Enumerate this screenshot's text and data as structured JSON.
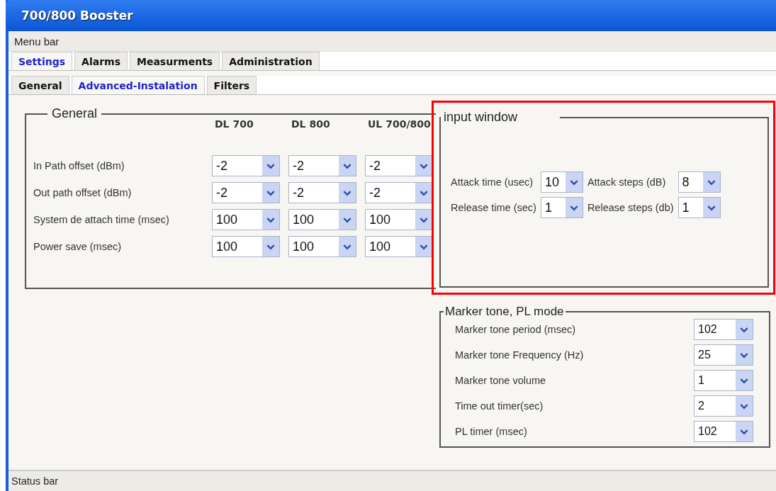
{
  "window": {
    "title": "700/800 Booster"
  },
  "menu_bar": "Menu bar",
  "tabs": [
    {
      "label": "Settings",
      "selected": true
    },
    {
      "label": "Alarms",
      "selected": false
    },
    {
      "label": "Measurments",
      "selected": false
    },
    {
      "label": "Administration",
      "selected": false
    }
  ],
  "subtabs": [
    {
      "label": "General",
      "selected": false
    },
    {
      "label": "Advanced-Instalation",
      "selected": true
    },
    {
      "label": "Filters",
      "selected": false
    }
  ],
  "general": {
    "title": "General",
    "columns": [
      "DL 700",
      "DL 800",
      "UL 700/800"
    ],
    "rows": [
      {
        "label": "In Path offset  (dBm)",
        "values": [
          "-2",
          "-2",
          "-2"
        ]
      },
      {
        "label": "Out path offset (dBm)",
        "values": [
          "-2",
          "-2",
          "-2"
        ]
      },
      {
        "label": "System de attach time (msec)",
        "values": [
          "100",
          "100",
          "100"
        ]
      },
      {
        "label": "Power save (msec)",
        "values": [
          "100",
          "100",
          "100"
        ]
      }
    ]
  },
  "input_window": {
    "title": "input window",
    "highlighted": true,
    "fields": [
      {
        "label": "Attack time (usec)",
        "value": "10"
      },
      {
        "label": "Attack steps (dB)",
        "value": "8"
      },
      {
        "label": "Release time (sec)",
        "value": "1"
      },
      {
        "label": "Release steps (db)",
        "value": "1"
      }
    ]
  },
  "marker": {
    "title": "Marker tone, PL mode",
    "fields": [
      {
        "label": "Marker tone period (msec)",
        "value": "102"
      },
      {
        "label": "Marker tone Frequency (Hz)",
        "value": "25"
      },
      {
        "label": "Marker tone volume",
        "value": "1"
      },
      {
        "label": "Time out timer(sec)",
        "value": "2"
      },
      {
        "label": "PL timer (msec)",
        "value": "102"
      }
    ]
  },
  "status_bar": "Status bar"
}
